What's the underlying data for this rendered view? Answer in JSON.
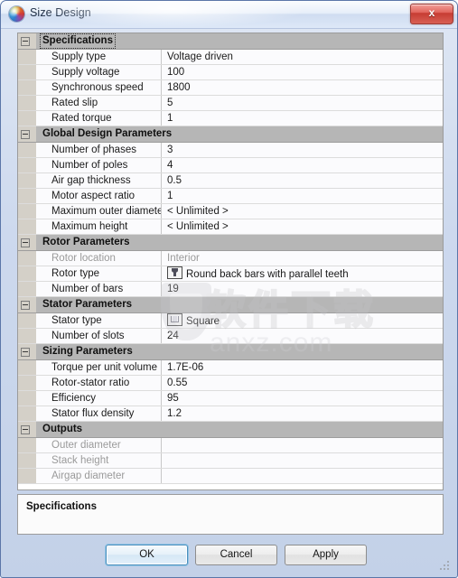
{
  "window": {
    "title": "Size Design",
    "app_icon": "sphere-logo-icon",
    "close_label": "x"
  },
  "grid": {
    "sections": [
      {
        "name": "Specifications",
        "selected": true,
        "rows": [
          {
            "label": "Supply type",
            "value": "Voltage driven",
            "disabled": false,
            "thumb": ""
          },
          {
            "label": "Supply voltage",
            "value": "100",
            "disabled": false,
            "thumb": ""
          },
          {
            "label": "Synchronous speed",
            "value": "1800",
            "disabled": false,
            "thumb": ""
          },
          {
            "label": "Rated slip",
            "value": "5",
            "disabled": false,
            "thumb": ""
          },
          {
            "label": "Rated torque",
            "value": "1",
            "disabled": false,
            "thumb": ""
          }
        ]
      },
      {
        "name": "Global Design Parameters",
        "selected": false,
        "rows": [
          {
            "label": "Number of phases",
            "value": "3",
            "disabled": false,
            "thumb": ""
          },
          {
            "label": "Number of poles",
            "value": "4",
            "disabled": false,
            "thumb": ""
          },
          {
            "label": "Air gap thickness",
            "value": "0.5",
            "disabled": false,
            "thumb": ""
          },
          {
            "label": "Motor aspect ratio",
            "value": "1",
            "disabled": false,
            "thumb": ""
          },
          {
            "label": "Maximum outer diameter",
            "value": "< Unlimited >",
            "disabled": false,
            "thumb": ""
          },
          {
            "label": "Maximum height",
            "value": "< Unlimited >",
            "disabled": false,
            "thumb": ""
          }
        ]
      },
      {
        "name": "Rotor Parameters",
        "selected": false,
        "rows": [
          {
            "label": "Rotor location",
            "value": "Interior",
            "disabled": true,
            "thumb": ""
          },
          {
            "label": "Rotor type",
            "value": "Round back bars with parallel teeth",
            "disabled": false,
            "thumb": "rotor"
          },
          {
            "label": "Number of bars",
            "value": "19",
            "disabled": false,
            "thumb": ""
          }
        ]
      },
      {
        "name": "Stator Parameters",
        "selected": false,
        "rows": [
          {
            "label": "Stator type",
            "value": "Square",
            "disabled": false,
            "thumb": "square"
          },
          {
            "label": "Number of slots",
            "value": "24",
            "disabled": false,
            "thumb": ""
          }
        ]
      },
      {
        "name": "Sizing Parameters",
        "selected": false,
        "rows": [
          {
            "label": "Torque per unit volume",
            "value": "1.7E-06",
            "disabled": false,
            "thumb": ""
          },
          {
            "label": "Rotor-stator ratio",
            "value": "0.55",
            "disabled": false,
            "thumb": ""
          },
          {
            "label": "Efficiency",
            "value": "95",
            "disabled": false,
            "thumb": ""
          },
          {
            "label": "Stator flux density",
            "value": "1.2",
            "disabled": false,
            "thumb": ""
          }
        ]
      },
      {
        "name": "Outputs",
        "selected": false,
        "rows": [
          {
            "label": "Outer diameter",
            "value": "",
            "disabled": true,
            "thumb": ""
          },
          {
            "label": "Stack height",
            "value": "",
            "disabled": true,
            "thumb": ""
          },
          {
            "label": "Airgap diameter",
            "value": "",
            "disabled": true,
            "thumb": ""
          }
        ]
      }
    ]
  },
  "description": {
    "title": "Specifications"
  },
  "buttons": {
    "ok": "OK",
    "cancel": "Cancel",
    "apply": "Apply"
  },
  "watermark": {
    "cjk": "软件下载",
    "domain": "anxz.com"
  }
}
